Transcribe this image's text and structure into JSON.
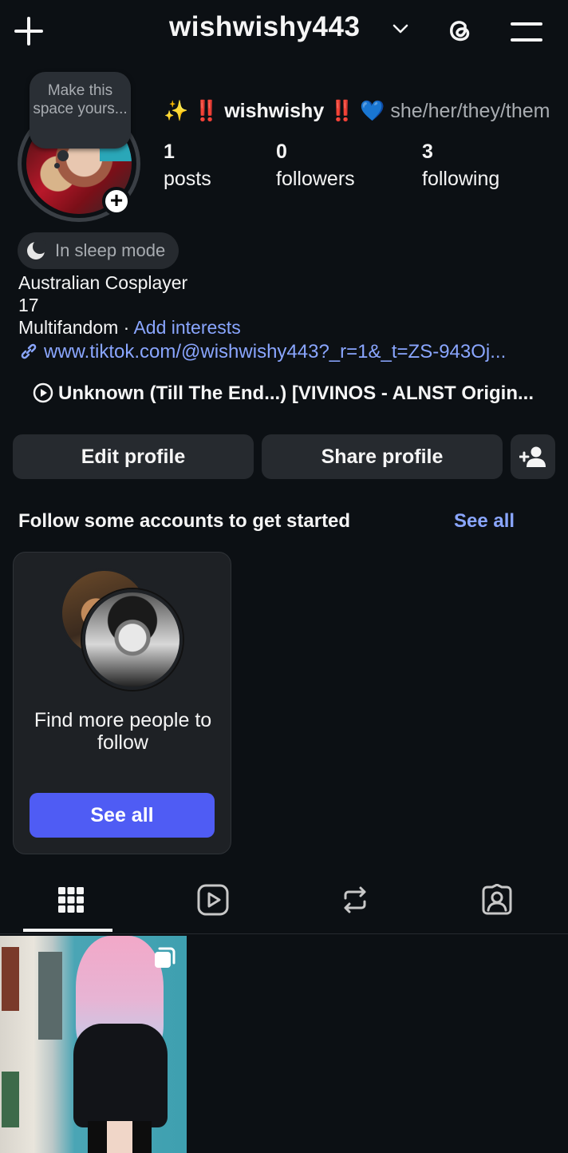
{
  "header": {
    "username": "wishwishy443",
    "icons": [
      "plus-icon",
      "chevron-down-icon",
      "threads-icon",
      "menu-icon"
    ]
  },
  "note": {
    "placeholder": "Make this space yours..."
  },
  "profile": {
    "name_prefix": "✨",
    "name_bang_left": "‼️",
    "display_name": "wishwishy",
    "name_bang_right": "‼️",
    "name_heart": "💙",
    "pronouns": "she/her/they/them",
    "stats": {
      "posts_count": "1",
      "posts_label": "posts",
      "followers_count": "0",
      "followers_label": "followers",
      "following_count": "3",
      "following_label": "following"
    },
    "status": "In sleep mode",
    "bio_line1": "Australian Cosplayer",
    "bio_line2": "17",
    "bio_line3": "Multifandom",
    "bio_separator": " · ",
    "add_interests": "Add interests",
    "link": "www.tiktok.com/@wishwishy443?_r=1&_t=ZS-943Oj...",
    "music": "Unknown (Till The End...) [VIVINOS - ALNST Origin..."
  },
  "actions": {
    "edit_label": "Edit profile",
    "share_label": "Share profile"
  },
  "suggestions": {
    "title": "Follow some accounts to get started",
    "see_all": "See all",
    "card_text": "Find more people to follow",
    "card_button": "See all"
  },
  "tabs": {
    "items": [
      "grid-icon",
      "reels-icon",
      "reposts-icon",
      "tagged-icon"
    ],
    "active": 0
  },
  "colors": {
    "background": "#0c1014",
    "surface": "#262a2f",
    "link": "#8aa6ff",
    "primary_button": "#4f5cf4"
  }
}
